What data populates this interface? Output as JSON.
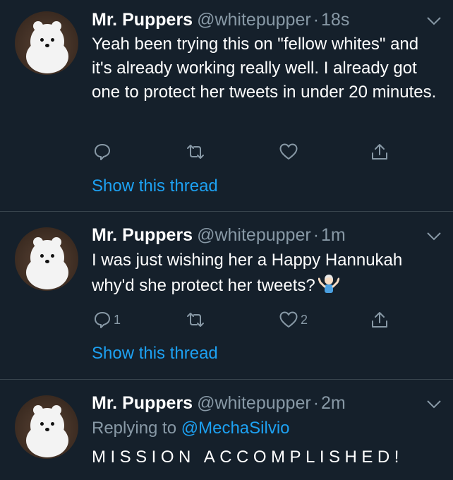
{
  "tweets": [
    {
      "name": "Mr. Puppers",
      "handle": "@whitepupper",
      "time_sep": "·",
      "time": "18s",
      "text": "Yeah been trying this on \"fellow whites\" and it's already working really well. I already got one to protect her tweets in under 20 minutes.",
      "reply_count": "",
      "retweet_count": "",
      "like_count": "",
      "show_thread": "Show this thread"
    },
    {
      "name": "Mr. Puppers",
      "handle": "@whitepupper",
      "time_sep": "·",
      "time": "1m",
      "text": "I was just wishing her a Happy Hannukah why'd she protect her tweets?",
      "text_emoji": "person-shrugging",
      "reply_count": "1",
      "retweet_count": "",
      "like_count": "2",
      "show_thread": "Show this thread"
    },
    {
      "name": "Mr. Puppers",
      "handle": "@whitepupper",
      "time_sep": "·",
      "time": "2m",
      "replying_prefix": "Replying to",
      "replying_to": "@MechaSilvio",
      "text": "MISSION ACCOMPLISHED!"
    }
  ],
  "colors": {
    "background": "#15202b",
    "divider": "#38444d",
    "secondary_text": "#8899a6",
    "link": "#1da1f2"
  },
  "icons": {
    "reply": "reply-icon",
    "retweet": "retweet-icon",
    "like": "heart-icon",
    "share": "share-icon",
    "caret": "chevron-down-icon"
  }
}
